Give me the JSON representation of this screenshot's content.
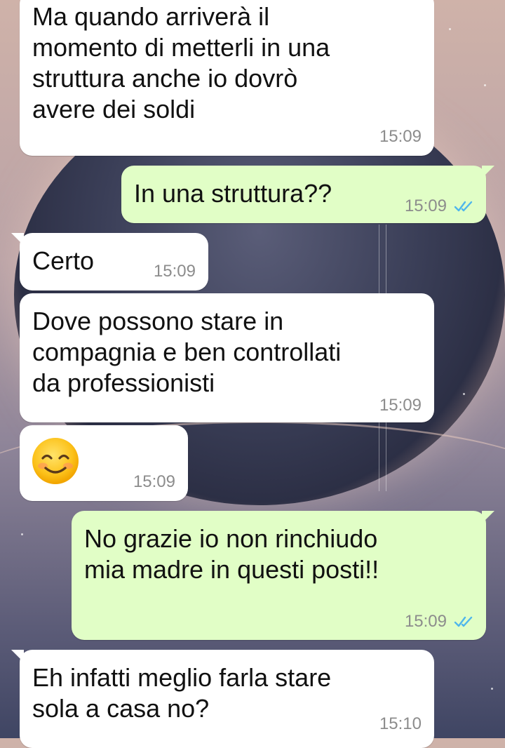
{
  "chat": {
    "messages": [
      {
        "direction": "in",
        "lines": [
          "Ma quando arriverà il",
          "momento di metterli in una",
          "struttura anche io dovrò",
          "avere dei soldi"
        ],
        "time": "15:09"
      },
      {
        "direction": "out",
        "text": "In una struttura??",
        "time": "15:09",
        "status": "read"
      },
      {
        "direction": "in",
        "text": "Certo",
        "time": "15:09"
      },
      {
        "direction": "in",
        "lines": [
          "Dove possono stare in",
          "compagnia e ben controllati",
          "da professionisti"
        ],
        "time": "15:09"
      },
      {
        "direction": "in",
        "emoji": "smiling-face-with-smiling-eyes",
        "time": "15:09"
      },
      {
        "direction": "out",
        "lines": [
          "No grazie io non rinchiudo",
          "mia madre in questi posti!!"
        ],
        "time": "15:09",
        "status": "read"
      },
      {
        "direction": "in",
        "lines": [
          "Eh infatti meglio farla stare",
          "sola a casa no?"
        ],
        "time": "15:10"
      }
    ]
  },
  "colors": {
    "incoming_bubble": "#ffffff",
    "outgoing_bubble": "#e1fec6",
    "timestamp": "#8c8c8c",
    "read_ticks": "#4fb6ec"
  }
}
